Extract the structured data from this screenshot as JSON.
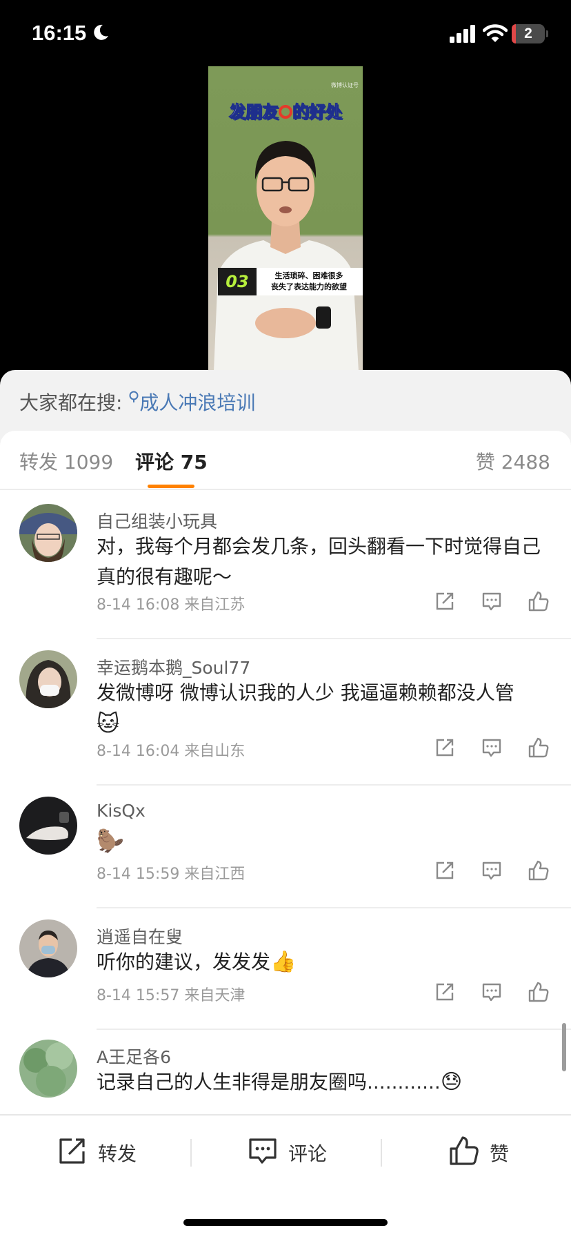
{
  "status_bar": {
    "time": "16:15",
    "battery": "2"
  },
  "video": {
    "logo": "微博认证号",
    "title_before": "发朋友",
    "title_after": "的好处",
    "caption_number": "03",
    "caption_line1": "生活琐碎、困难很多",
    "caption_line2": "丧失了表达能力的欲望"
  },
  "search": {
    "prefix": "大家都在搜:",
    "keyword": "成人冲浪培训"
  },
  "tabs": {
    "repost": "转发 1099",
    "comment": "评论 75",
    "like": "赞 2488"
  },
  "comments": [
    {
      "name": "自己组装小玩具",
      "text": "对，我每个月都会发几条，回头翻看一下时觉得自己真的很有趣呢～",
      "meta": "8-14 16:08 来自江苏"
    },
    {
      "name": "幸运鹅本鹅_Soul77",
      "text": "发微博呀 微博认识我的人少 我逼逼赖赖都没人管",
      "emoji": "🐱",
      "meta": "8-14 16:04 来自山东"
    },
    {
      "name": "KisQx",
      "text": "",
      "emoji": "🦫",
      "meta": "8-14 15:59 来自江西"
    },
    {
      "name": "逍遥自在叟",
      "text": "听你的建议，发发发",
      "emoji": "👍",
      "meta": "8-14 15:57 来自天津"
    },
    {
      "name": "A王足各6",
      "text": "记录自己的人生非得是朋友圈吗............",
      "emoji": "😓",
      "meta": ""
    }
  ],
  "toolbar": {
    "repost": "转发",
    "comment": "评论",
    "like": "赞"
  },
  "colors": {
    "accent": "#ff8200",
    "link": "#4a79b5"
  },
  "icons": [
    "moon-icon",
    "signal-icon",
    "wifi-icon",
    "repost-icon",
    "comment-icon",
    "like-icon"
  ]
}
